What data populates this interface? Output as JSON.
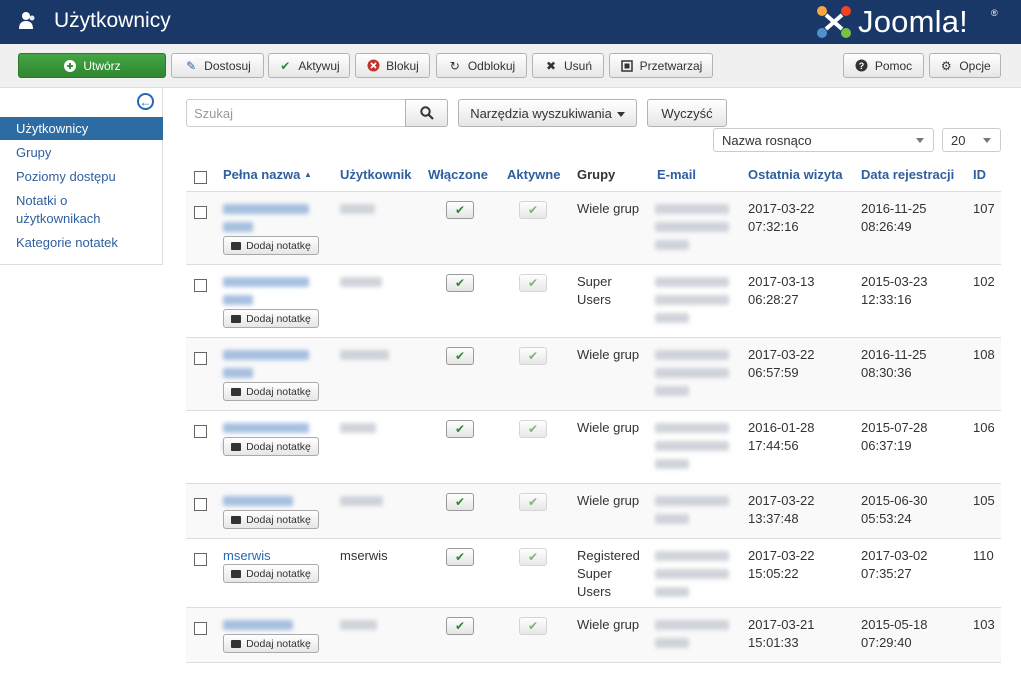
{
  "header": {
    "title": "Użytkownicy",
    "logo_text": "Joomla!",
    "logo_reg": "®"
  },
  "toolbar": {
    "create": "Utwórz",
    "edit": "Dostosuj",
    "activate": "Aktywuj",
    "block": "Blokuj",
    "unblock": "Odblokuj",
    "delete": "Usuń",
    "batch": "Przetwarzaj",
    "help": "Pomoc",
    "options": "Opcje"
  },
  "sidebar": {
    "items": [
      {
        "label": "Użytkownicy",
        "active": true
      },
      {
        "label": "Grupy"
      },
      {
        "label": "Poziomy dostępu"
      },
      {
        "label": "Notatki o użytkownikach"
      },
      {
        "label": "Kategorie notatek"
      }
    ]
  },
  "filters": {
    "search_placeholder": "Szukaj",
    "search_tools": "Narzędzia wyszukiwania",
    "clear": "Wyczyść",
    "ordering": "Nazwa rosnąco",
    "limit": "20"
  },
  "table": {
    "headers": {
      "name": "Pełna nazwa",
      "sort_indicator": "▲",
      "username": "Użytkownik",
      "enabled": "Włączone",
      "activated": "Aktywne",
      "groups": "Grupy",
      "email": "E-mail",
      "last_visit": "Ostatnia wizyta",
      "registered": "Data rejestracji",
      "id": "ID"
    },
    "note_button": "Dodaj notatkę",
    "rows": [
      {
        "name": "",
        "username": "",
        "groups": [
          "Wiele grup"
        ],
        "last_visit": [
          "2017-03-22",
          "07:32:16"
        ],
        "registered": [
          "2016-11-25",
          "08:26:49"
        ],
        "id": "107"
      },
      {
        "name": "",
        "username": "",
        "groups": [
          "Super",
          "Users"
        ],
        "last_visit": [
          "2017-03-13",
          "06:28:27"
        ],
        "registered": [
          "2015-03-23",
          "12:33:16"
        ],
        "id": "102"
      },
      {
        "name": "",
        "username": "",
        "groups": [
          "Wiele grup"
        ],
        "last_visit": [
          "2017-03-22",
          "06:57:59"
        ],
        "registered": [
          "2016-11-25",
          "08:30:36"
        ],
        "id": "108"
      },
      {
        "name": "",
        "username": "",
        "groups": [
          "Wiele grup"
        ],
        "last_visit": [
          "2016-01-28",
          "17:44:56"
        ],
        "registered": [
          "2015-07-28",
          "06:37:19"
        ],
        "id": "106"
      },
      {
        "name": "",
        "username": "",
        "groups": [
          "Wiele grup"
        ],
        "last_visit": [
          "2017-03-22",
          "13:37:48"
        ],
        "registered": [
          "2015-06-30",
          "05:53:24"
        ],
        "id": "105"
      },
      {
        "name": "mserwis",
        "username": "mserwis",
        "groups": [
          "Registered",
          "Super",
          "Users"
        ],
        "last_visit": [
          "2017-03-22",
          "15:05:22"
        ],
        "registered": [
          "2017-03-02",
          "07:35:27"
        ],
        "id": "110"
      },
      {
        "name": "",
        "username": "",
        "groups": [
          "Wiele grup"
        ],
        "last_visit": [
          "2017-03-21",
          "15:01:33"
        ],
        "registered": [
          "2015-05-18",
          "07:29:40"
        ],
        "id": "103"
      }
    ]
  },
  "icons": {
    "users": "users-icon",
    "search": "search-icon",
    "check": "check-icon",
    "note": "note-icon",
    "help": "help-icon",
    "gear": "gear-icon",
    "back": "back-arrow-icon"
  },
  "colors": {
    "header_bg": "#1a3867",
    "success": "#46a546",
    "link": "#2668b8",
    "active_nav": "#2d6ca2"
  }
}
